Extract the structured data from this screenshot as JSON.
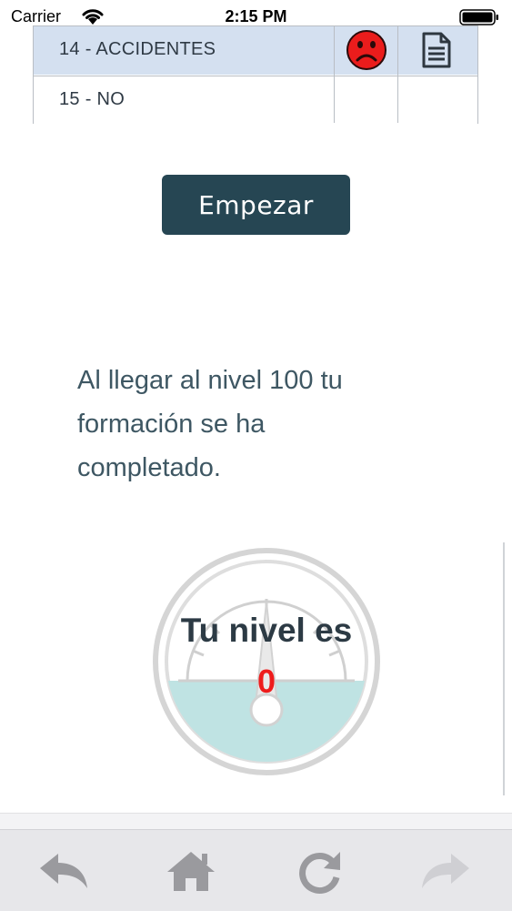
{
  "status_bar": {
    "carrier": "Carrier",
    "time": "2:15 PM"
  },
  "table": {
    "rows": [
      {
        "label": "14 - ACCIDENTES",
        "status_icon": "sad-face-icon",
        "doc_icon": "document-icon"
      },
      {
        "label": "15 - NO"
      }
    ]
  },
  "start_button": {
    "label": "Empezar"
  },
  "info": {
    "line1": "Al llegar al nivel 100 tu",
    "line2": "formación se ha",
    "line3": "completado."
  },
  "gauge": {
    "title": "Tu nivel es",
    "value": "0",
    "level": 0
  },
  "toolbar": {
    "icons": [
      "back-icon",
      "home-icon",
      "reload-icon",
      "forward-icon"
    ]
  },
  "colors": {
    "button_bg": "#264653",
    "row_highlight": "#d4e0f0",
    "gauge_fill": "#bfe3e3",
    "value_red": "#ee1c1c"
  }
}
